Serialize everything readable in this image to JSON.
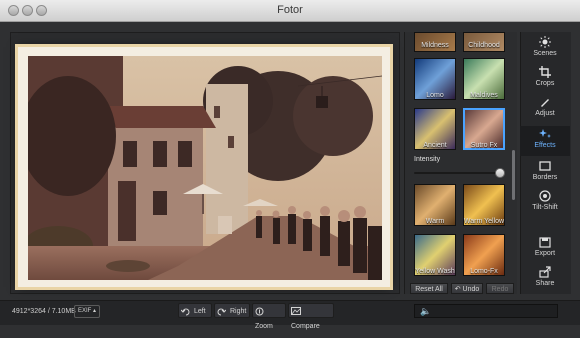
{
  "window": {
    "title": "Fotor"
  },
  "status": {
    "dimensions": "4912*3264 / 7.10MB",
    "exif_label": "EXIF ▴"
  },
  "bottom_tools": {
    "left": "Left",
    "right": "Right",
    "zoom": "Zoom",
    "compare": "Compare"
  },
  "effects_panel": {
    "thumbnails": [
      {
        "label": "Mildness"
      },
      {
        "label": "Childhood"
      },
      {
        "label": "Lomo"
      },
      {
        "label": "Maldives"
      },
      {
        "label": "Ancient"
      },
      {
        "label": "Sutro Fx",
        "selected": true
      },
      {
        "label": "Warm"
      },
      {
        "label": "Warm Yellow"
      },
      {
        "label": "Yellow Wash"
      },
      {
        "label": "Lomo-Fx"
      }
    ],
    "intensity_label": "Intensity",
    "intensity_value": 1.0,
    "reset_label": "Reset All",
    "undo_label": "Undo",
    "redo_label": "Redo"
  },
  "side_tools": {
    "scenes": "Scenes",
    "crops": "Crops",
    "adjust": "Adjust",
    "effects": "Effects",
    "borders": "Borders",
    "tiltshift": "Tilt-Shift",
    "export": "Export",
    "share": "Share"
  },
  "colors": {
    "accent": "#4aa3ff",
    "background": "#2f3032",
    "speaker": "#f0b000"
  }
}
